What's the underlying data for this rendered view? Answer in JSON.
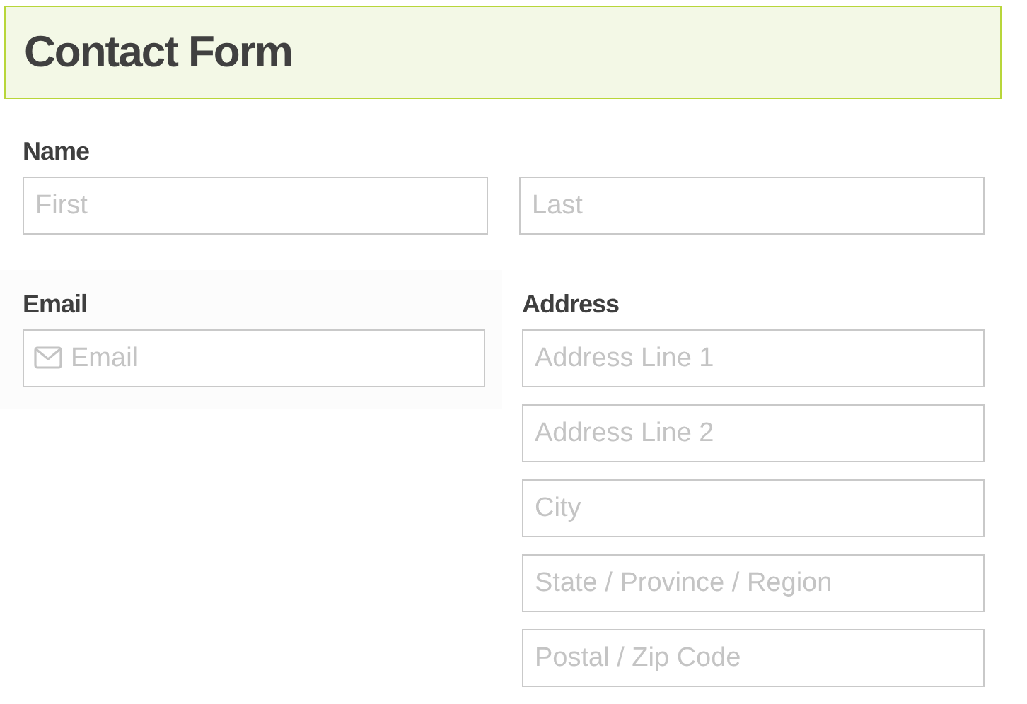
{
  "title": "Contact Form",
  "name": {
    "label": "Name",
    "fields": [
      {
        "placeholder": "First"
      },
      {
        "placeholder": "Last"
      }
    ]
  },
  "email": {
    "label": "Email",
    "placeholder": "Email"
  },
  "address": {
    "label": "Address",
    "fields": [
      {
        "placeholder": "Address Line 1"
      },
      {
        "placeholder": "Address Line 2"
      },
      {
        "placeholder": "City"
      },
      {
        "placeholder": "State / Province / Region"
      },
      {
        "placeholder": "Postal / Zip Code"
      }
    ]
  }
}
